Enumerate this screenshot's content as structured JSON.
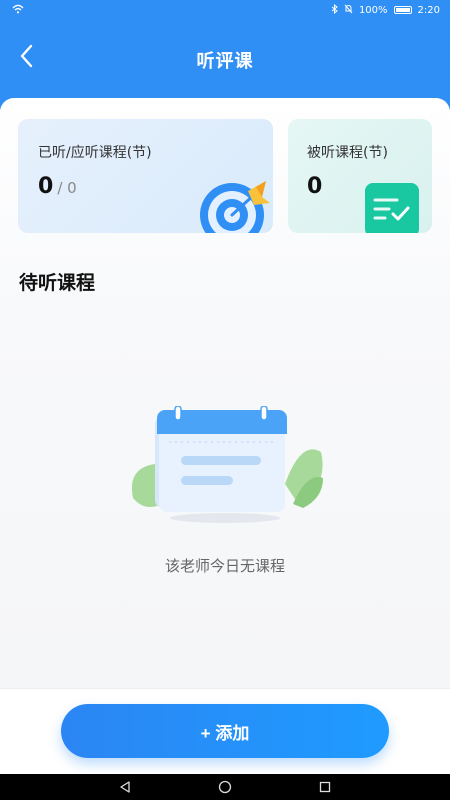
{
  "status_bar": {
    "battery_text": "100%",
    "time": "2:20"
  },
  "header": {
    "title": "听评课"
  },
  "cards": {
    "left": {
      "label": "已听/应听课程(节)",
      "value": "0",
      "total": "/ 0"
    },
    "right": {
      "label": "被听课程(节)",
      "value": "0"
    }
  },
  "section": {
    "title": "待听课程"
  },
  "empty_state": {
    "text": "该老师今日无课程"
  },
  "add_button": {
    "label": "+ 添加"
  },
  "icons": {
    "back": "chevron-left-icon",
    "target": "target-icon",
    "list": "checklist-icon",
    "calendar": "calendar-illustration",
    "wifi": "wifi-icon",
    "bluetooth": "bluetooth-icon",
    "mute": "mute-icon",
    "battery": "battery-icon"
  },
  "colors": {
    "primary": "#2f8ff5",
    "accent_green": "#19c7a0",
    "text": "#111111"
  }
}
